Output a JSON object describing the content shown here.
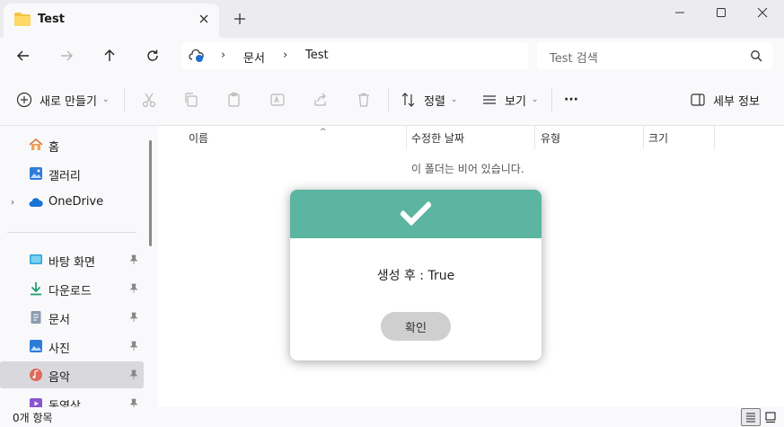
{
  "window": {
    "tab_title": "Test"
  },
  "address": {
    "crumbs": [
      "문서",
      "Test"
    ],
    "search_placeholder": "Test 검색"
  },
  "commands": {
    "new": "새로 만들기",
    "sort": "정렬",
    "view": "보기",
    "more": "···",
    "details": "세부 정보"
  },
  "sidebar": {
    "items": [
      {
        "label": "홈",
        "icon": "home-icon"
      },
      {
        "label": "갤러리",
        "icon": "gallery-icon"
      },
      {
        "label": "OneDrive",
        "icon": "cloud-icon"
      },
      {
        "label": "바탕 화면",
        "icon": "desktop-icon"
      },
      {
        "label": "다운로드",
        "icon": "download-icon"
      },
      {
        "label": "문서",
        "icon": "document-icon"
      },
      {
        "label": "사진",
        "icon": "pictures-icon"
      },
      {
        "label": "음악",
        "icon": "music-icon"
      },
      {
        "label": "동영상",
        "icon": "video-icon"
      }
    ]
  },
  "columns": [
    "이름",
    "수정한 날짜",
    "유형",
    "크기"
  ],
  "empty_message": "이 폴더는 비어 있습니다.",
  "status": {
    "count": "0개 항목"
  },
  "dialog": {
    "message": "생성 후 : True",
    "ok_label": "확인",
    "header_color": "#5cb5a0"
  }
}
